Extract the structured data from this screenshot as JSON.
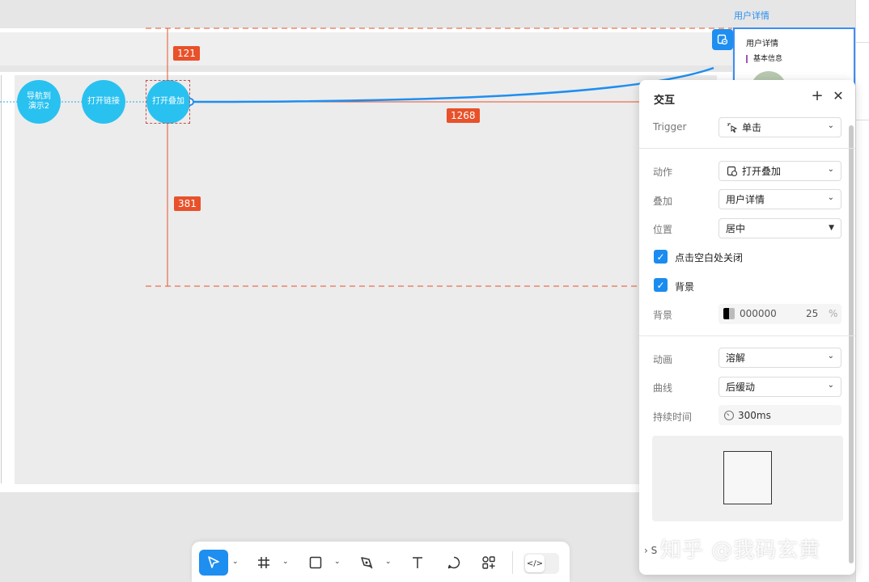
{
  "canvas": {
    "nodes": [
      {
        "label": "导航到\n演示2"
      },
      {
        "label": "打开链接"
      },
      {
        "label": "打开叠加"
      }
    ],
    "measurements": {
      "top": "121",
      "right": "1268",
      "bottom": "381"
    },
    "overlay_preview": {
      "frame_label": "用户详情",
      "header": "用户详情",
      "section": "基本信息"
    }
  },
  "panel": {
    "title": "交互",
    "add_icon": "plus-icon",
    "close_icon": "close-icon",
    "trigger": {
      "label": "Trigger",
      "value": "单击"
    },
    "action": {
      "label": "动作",
      "value": "打开叠加"
    },
    "overlay": {
      "label": "叠加",
      "value": "用户详情"
    },
    "position": {
      "label": "位置",
      "value": "居中"
    },
    "close_on_click_outside": {
      "label": "点击空白处关闭",
      "checked": true
    },
    "background_toggle": {
      "label": "背景",
      "checked": true
    },
    "background": {
      "label": "背景",
      "hex": "000000",
      "opacity": "25",
      "unit": "%"
    },
    "animation": {
      "label": "动画",
      "value": "溶解"
    },
    "curve": {
      "label": "曲线",
      "value": "后缓动"
    },
    "duration": {
      "label": "持续时间",
      "value": "300ms"
    },
    "footer": "S"
  },
  "toolbar": {
    "tools": [
      "select-tool",
      "frame-tool",
      "rectangle-tool",
      "pen-tool",
      "text-tool",
      "comment-tool",
      "components-tool",
      "code-tool"
    ]
  },
  "watermark": "知乎 @我码玄黄",
  "colors": {
    "accent": "#1e8ef0",
    "node": "#29c1f0",
    "measure": "#e8512a",
    "link": "#2a8ff0"
  }
}
